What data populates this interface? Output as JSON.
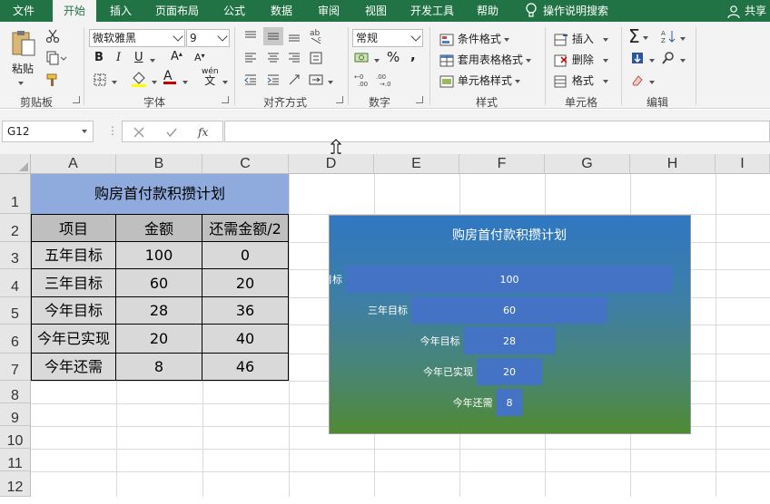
{
  "ribbon_tabs": [
    "文件",
    "开始",
    "插入",
    "页面布局",
    "公式",
    "数据",
    "审阅",
    "视图",
    "开发工具",
    "帮助"
  ],
  "active_tab": "开始",
  "tell_me": "操作说明搜索",
  "share": "共享",
  "clipboard": {
    "paste": "粘贴",
    "group": "剪贴板"
  },
  "font": {
    "name": "微软雅黑",
    "size": "9",
    "bold": "B",
    "italic": "I",
    "underline": "U",
    "group": "字体",
    "wen": "wén",
    "wen_char": "文",
    "color_a": "A"
  },
  "alignment": {
    "group": "对齐方式"
  },
  "number": {
    "format": "常规",
    "percent": "%",
    "comma": ",",
    "group": "数字"
  },
  "styles": {
    "conditional": "条件格式",
    "table": "套用表格格式",
    "cell": "单元格样式",
    "group": "样式"
  },
  "cells": {
    "insert": "插入",
    "delete": "删除",
    "format": "格式",
    "group": "单元格"
  },
  "editing": {
    "group": "编辑"
  },
  "formula_bar": {
    "name_box": "G12",
    "formula": ""
  },
  "columns": [
    "A",
    "B",
    "C",
    "D",
    "E",
    "F",
    "G",
    "H",
    "I"
  ],
  "rows": [
    "1",
    "2",
    "3",
    "4",
    "5",
    "6",
    "7",
    "8",
    "9",
    "10",
    "11",
    "12"
  ],
  "sheet": {
    "title": "购房首付款积攒计划",
    "headers": [
      "项目",
      "金额",
      "还需金额/2"
    ],
    "data": [
      [
        "五年目标",
        "100",
        "0"
      ],
      [
        "三年目标",
        "60",
        "20"
      ],
      [
        "今年目标",
        "28",
        "36"
      ],
      [
        "今年已实现",
        "20",
        "40"
      ],
      [
        "今年还需",
        "8",
        "46"
      ]
    ]
  },
  "chart_data": {
    "type": "bar",
    "subtype": "funnel (stacked bar with invisible offset series)",
    "title": "购房首付款积攒计划",
    "categories": [
      "五年目标",
      "三年目标",
      "今年目标",
      "今年已实现",
      "今年还需"
    ],
    "series": [
      {
        "name": "金额",
        "values": [
          100,
          60,
          28,
          20,
          8
        ]
      },
      {
        "name": "还需金额/2",
        "values": [
          0,
          20,
          36,
          40,
          46
        ]
      }
    ],
    "xlim": [
      0,
      100
    ],
    "grid": false,
    "data_labels": [
      "100",
      "60",
      "28",
      "20",
      "8"
    ],
    "bar_color": "#4472c4",
    "background_gradient": [
      "#2f77c2",
      "#4f8a33"
    ]
  },
  "colors": {
    "excel_green": "#217346",
    "title_fill": "#8faadc",
    "header_fill": "#bfbfbf",
    "body_fill": "#d9d9d9"
  }
}
